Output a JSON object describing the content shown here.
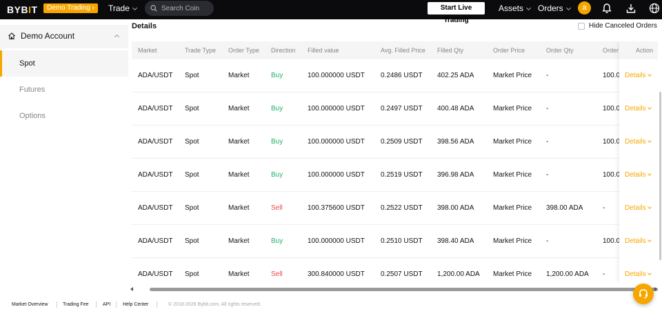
{
  "brand": {
    "logo_text_1": "BYB",
    "logo_text_i": "I",
    "logo_text_2": "T",
    "accent": "#f7a600"
  },
  "header": {
    "demo_badge": "Demo Trading",
    "trade_label": "Trade",
    "search_placeholder": "Search Coin",
    "live_button": "Start Live Trading",
    "assets_label": "Assets",
    "orders_label": "Orders",
    "avatar_letter": "a",
    "icons": [
      "bell-icon",
      "download-icon",
      "globe-icon"
    ]
  },
  "sidebar": {
    "section_label": "Demo Account",
    "items": [
      {
        "label": "Spot",
        "active": true
      },
      {
        "label": "Futures",
        "active": false
      },
      {
        "label": "Options",
        "active": false
      }
    ]
  },
  "main": {
    "title": "Details",
    "hide_canceled_label": "Hide Canceled Orders",
    "columns": [
      "Market",
      "Trade Type",
      "Order Type",
      "Direction",
      "Filled value",
      "Avg. Filled Price",
      "Filled Qty",
      "Order Price",
      "Order Qty",
      "Order",
      "Action"
    ],
    "rows": [
      {
        "market": "ADA/USDT",
        "trade_type": "Spot",
        "order_type": "Market",
        "direction": "Buy",
        "filled_value": "100.000000 USDT",
        "avg_price": "0.2486 USDT",
        "filled_qty": "402.25 ADA",
        "order_price": "Market Price",
        "order_qty": "-",
        "order": "100.0",
        "action": "Details"
      },
      {
        "market": "ADA/USDT",
        "trade_type": "Spot",
        "order_type": "Market",
        "direction": "Buy",
        "filled_value": "100.000000 USDT",
        "avg_price": "0.2497 USDT",
        "filled_qty": "400.48 ADA",
        "order_price": "Market Price",
        "order_qty": "-",
        "order": "100.0",
        "action": "Details"
      },
      {
        "market": "ADA/USDT",
        "trade_type": "Spot",
        "order_type": "Market",
        "direction": "Buy",
        "filled_value": "100.000000 USDT",
        "avg_price": "0.2509 USDT",
        "filled_qty": "398.56 ADA",
        "order_price": "Market Price",
        "order_qty": "-",
        "order": "100.0",
        "action": "Details"
      },
      {
        "market": "ADA/USDT",
        "trade_type": "Spot",
        "order_type": "Market",
        "direction": "Buy",
        "filled_value": "100.000000 USDT",
        "avg_price": "0.2519 USDT",
        "filled_qty": "396.98 ADA",
        "order_price": "Market Price",
        "order_qty": "-",
        "order": "100.0",
        "action": "Details"
      },
      {
        "market": "ADA/USDT",
        "trade_type": "Spot",
        "order_type": "Market",
        "direction": "Sell",
        "filled_value": "100.375600 USDT",
        "avg_price": "0.2522 USDT",
        "filled_qty": "398.00 ADA",
        "order_price": "Market Price",
        "order_qty": "398.00 ADA",
        "order": "-",
        "action": "Details"
      },
      {
        "market": "ADA/USDT",
        "trade_type": "Spot",
        "order_type": "Market",
        "direction": "Buy",
        "filled_value": "100.000000 USDT",
        "avg_price": "0.2510 USDT",
        "filled_qty": "398.40 ADA",
        "order_price": "Market Price",
        "order_qty": "-",
        "order": "100.0",
        "action": "Details"
      },
      {
        "market": "ADA/USDT",
        "trade_type": "Spot",
        "order_type": "Market",
        "direction": "Sell",
        "filled_value": "300.840000 USDT",
        "avg_price": "0.2507 USDT",
        "filled_qty": "1,200.00 ADA",
        "order_price": "Market Price",
        "order_qty": "1,200.00 ADA",
        "order": "-",
        "action": "Details"
      }
    ]
  },
  "footer": {
    "links": [
      "Market Overview",
      "Trading Fee",
      "API",
      "Help Center"
    ],
    "copyright": "© 2018-2026 Bybit.com. All rights reserved."
  },
  "colors": {
    "buy": "#20b26c",
    "sell": "#ef454a",
    "link": "#f7a600"
  }
}
